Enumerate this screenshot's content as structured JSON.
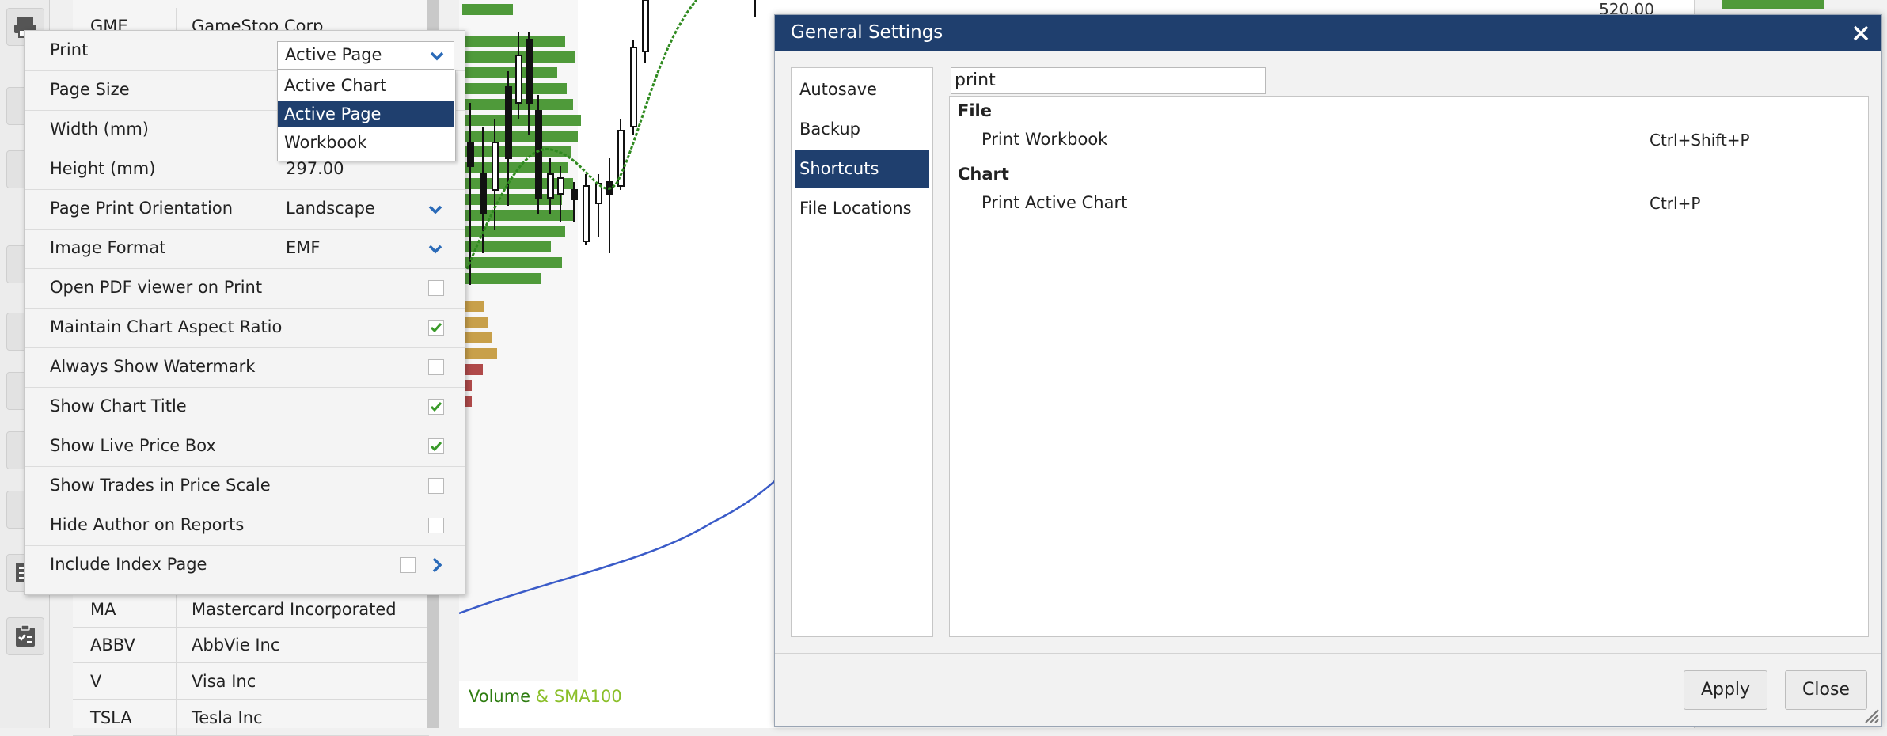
{
  "watchlist": {
    "rows": [
      {
        "symbol": "GME",
        "name": "GameStop Corp"
      },
      {
        "symbol": "MA",
        "name": "Mastercard Incorporated"
      },
      {
        "symbol": "ABBV",
        "name": "AbbVie Inc"
      },
      {
        "symbol": "V",
        "name": "Visa Inc"
      },
      {
        "symbol": "TSLA",
        "name": "Tesla Inc"
      }
    ]
  },
  "chart": {
    "price_label": "520.00",
    "volume_label": "Volume",
    "sma_label": "& SMA100",
    "volume_color": "#2f7d12",
    "sma_color": "#8bbf2a"
  },
  "print_panel": {
    "rows": [
      {
        "label": "Print",
        "value": "Active Page",
        "kind": "select"
      },
      {
        "label": "Page Size",
        "value": "",
        "kind": "select"
      },
      {
        "label": "Width (mm)",
        "value": "",
        "kind": "text"
      },
      {
        "label": "Height (mm)",
        "value": "297.00",
        "kind": "text"
      },
      {
        "label": "Page Print Orientation",
        "value": "Landscape",
        "kind": "select"
      },
      {
        "label": "Image Format",
        "value": "EMF",
        "kind": "select"
      },
      {
        "label": "Open PDF viewer on Print",
        "kind": "check",
        "checked": false
      },
      {
        "label": "Maintain Chart Aspect Ratio",
        "kind": "check",
        "checked": true
      },
      {
        "label": "Always Show Watermark",
        "kind": "check",
        "checked": false
      },
      {
        "label": "Show Chart Title",
        "kind": "check",
        "checked": true
      },
      {
        "label": "Show Live Price Box",
        "kind": "check",
        "checked": true
      },
      {
        "label": "Show Trades in Price Scale",
        "kind": "check",
        "checked": false
      },
      {
        "label": "Hide Author on Reports",
        "kind": "check",
        "checked": false
      },
      {
        "label": "Include Index Page",
        "kind": "check-arrow",
        "checked": false
      }
    ],
    "dropdown": {
      "selected": "Active Page",
      "options": [
        "Active Chart",
        "Active Page",
        "Workbook"
      ]
    }
  },
  "dialog": {
    "title": "General Settings",
    "nav": [
      "Autosave",
      "Backup",
      "Shortcuts",
      "File Locations"
    ],
    "nav_selected": "Shortcuts",
    "search_value": "print",
    "groups": [
      {
        "name": "File",
        "items": [
          {
            "label": "Print Workbook",
            "shortcut": "Ctrl+Shift+P"
          }
        ]
      },
      {
        "name": "Chart",
        "items": [
          {
            "label": "Print Active Chart",
            "shortcut": "Ctrl+P"
          }
        ]
      }
    ],
    "apply_label": "Apply",
    "close_label": "Close"
  },
  "colors": {
    "accent": "#1f3f6e",
    "check_green": "#3a9a2a",
    "chevron_blue": "#2a6ab8"
  }
}
